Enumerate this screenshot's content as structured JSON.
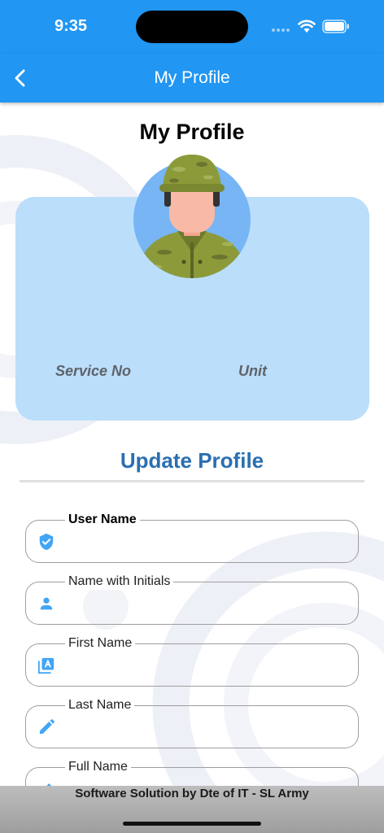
{
  "status_bar": {
    "time": "9:35"
  },
  "app_bar": {
    "title": "My Profile"
  },
  "profile": {
    "heading": "My Profile",
    "service_no_label": "Service No",
    "unit_label": "Unit"
  },
  "update_section": {
    "heading": "Update Profile",
    "fields": [
      {
        "label": "User Name",
        "icon": "verified-shield-icon"
      },
      {
        "label": "Name with Initials",
        "icon": "person-icon"
      },
      {
        "label": "First Name",
        "icon": "letter-a-icon"
      },
      {
        "label": "Last Name",
        "icon": "pencil-icon"
      },
      {
        "label": "Full Name",
        "icon": "pencil-icon"
      }
    ]
  },
  "footer": {
    "text": "Software Solution by Dte of IT - SL Army"
  },
  "colors": {
    "primary": "#2196f3",
    "card": "#bbdefb",
    "accent_text": "#2a6fb0"
  }
}
